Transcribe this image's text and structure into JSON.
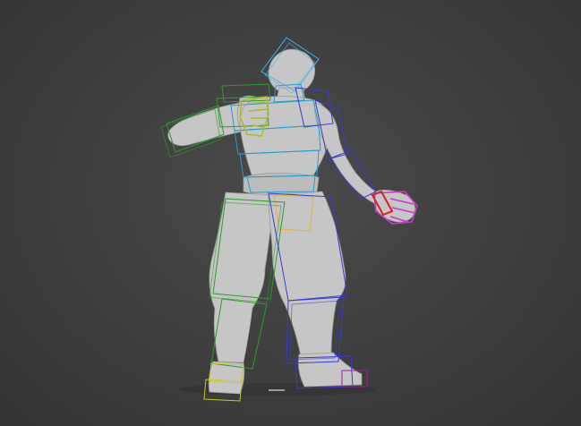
{
  "viewport": {
    "background_color": "#3f3f3f",
    "mesh_color": "#c9c9c9",
    "rig_colors": {
      "spine_and_head": "#45b7e8",
      "left_side": "#2f9a2f",
      "right_side": "#3a3ad0",
      "left_hand": "#b6b62c",
      "right_hand": "#c83ac8",
      "pelvis": "#e3b43a",
      "left_foot": "#c6c63a",
      "right_foot": "#a020a0",
      "selected_finger": "#d82020"
    }
  }
}
